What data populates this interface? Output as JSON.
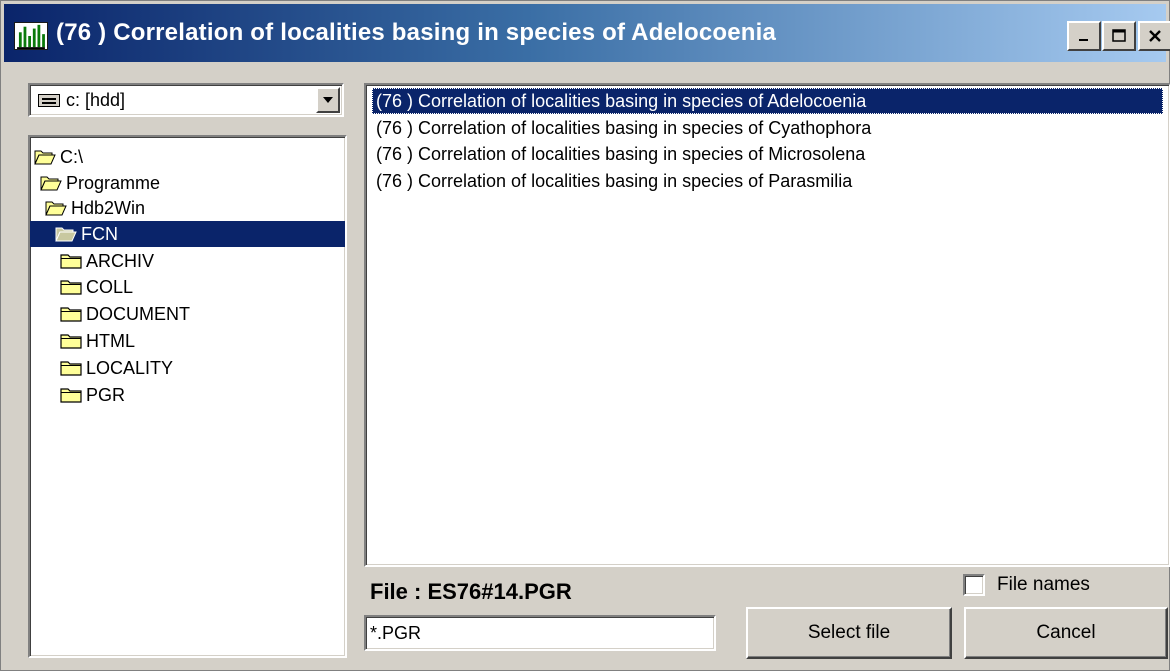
{
  "window": {
    "title": "(76 ) Correlation of localities basing in species of Adelocoenia",
    "app_icon": "species-chart-icon",
    "controls": {
      "minimize": "minimize-icon",
      "maximize": "maximize-icon",
      "close": "close-icon"
    }
  },
  "drive_select": {
    "value": "c: [hdd]",
    "icon": "hard-drive-icon"
  },
  "folder_tree": {
    "items": [
      {
        "label": "C:\\",
        "icon": "open-folder-icon"
      },
      {
        "label": "Programme",
        "icon": "open-folder-icon"
      },
      {
        "label": "Hdb2Win",
        "icon": "open-folder-icon"
      },
      {
        "label": "FCN",
        "icon": "open-folder-icon",
        "selected": true
      },
      {
        "label": "ARCHIV",
        "icon": "folder-icon"
      },
      {
        "label": "COLL",
        "icon": "folder-icon"
      },
      {
        "label": "DOCUMENT",
        "icon": "folder-icon"
      },
      {
        "label": "HTML",
        "icon": "folder-icon"
      },
      {
        "label": "LOCALITY",
        "icon": "folder-icon"
      },
      {
        "label": "PGR",
        "icon": "folder-icon"
      }
    ]
  },
  "file_list": {
    "items": [
      {
        "label": "(76 ) Correlation of localities basing in species of Adelocoenia",
        "selected": true
      },
      {
        "label": "(76 ) Correlation of localities basing in species of Cyathophora"
      },
      {
        "label": "(76 ) Correlation of localities basing in species of Microsolena"
      },
      {
        "label": "(76 ) Correlation of localities basing in species of Parasmilia"
      }
    ]
  },
  "file_info": {
    "label": "File : ES76#14.PGR"
  },
  "filter": {
    "value": "*.PGR"
  },
  "options": {
    "file_names_label": "File names",
    "file_names_checked": false
  },
  "buttons": {
    "select": "Select file",
    "cancel": "Cancel"
  },
  "colors": {
    "selection": "#0a246a",
    "face": "#d4d0c8",
    "title_start": "#0a246a",
    "title_end": "#a6caf0"
  }
}
